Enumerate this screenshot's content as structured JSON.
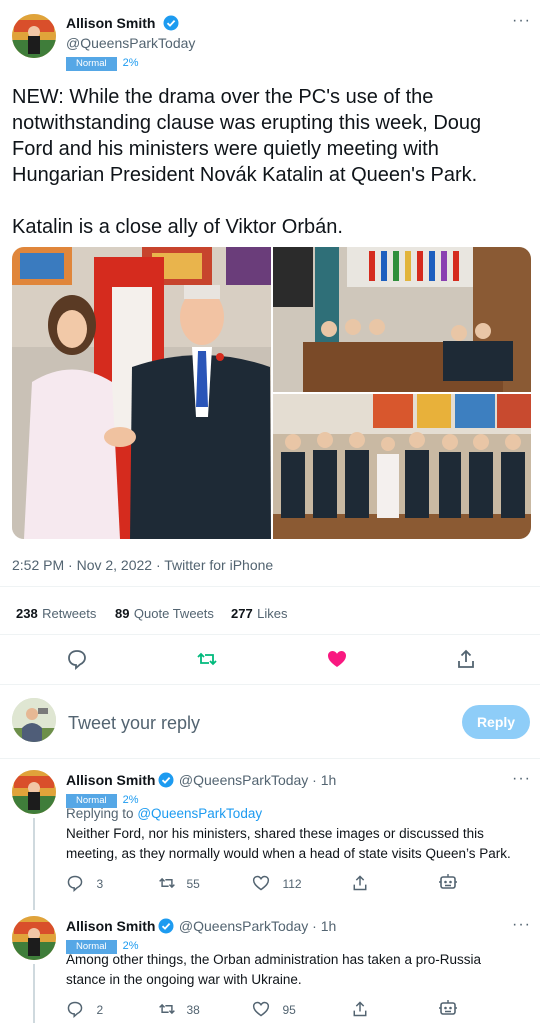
{
  "main_tweet": {
    "author_name": "Allison Smith",
    "author_handle": "@QueensParkToday",
    "badge_label": "Normal",
    "badge_pct": "2%",
    "text_line1": "NEW: While the drama over the PC's use of the",
    "text_line2": "notwithstanding clause was erupting this week, Doug",
    "text_line3": "Ford and his ministers were quietly meeting with",
    "text_line4": "Hungarian President Novák Katalin at Queen's Park.",
    "text_line5": "Katalin is a close ally of Viktor Orbán.",
    "timestamp": "2:52 PM · Nov 2, 2022 · Twitter for iPhone",
    "retweets_count": "238",
    "retweets_label": "Retweets",
    "quotes_count": "89",
    "quotes_label": "Quote Tweets",
    "likes_count": "277",
    "likes_label": "Likes"
  },
  "compose": {
    "placeholder": "Tweet your reply",
    "button_label": "Reply"
  },
  "replies": [
    {
      "author_name": "Allison Smith",
      "author_handle": "@QueensParkToday · 1h",
      "badge_label": "Normal",
      "badge_pct": "2%",
      "replying_prefix": "Replying to",
      "replying_handle": "@QueensParkToday",
      "text_line1": "Neither Ford, nor his ministers, shared these images or discussed this",
      "text_line2": "meeting, as they normally would when a head of state visits Queen’s Park.",
      "reply_count": "3",
      "retweet_count": "55",
      "like_count": "112"
    },
    {
      "author_name": "Allison Smith",
      "author_handle": "@QueensParkToday · 1h",
      "badge_label": "Normal",
      "badge_pct": "2%",
      "text_line1": "Among other things, the Orban administration has taken a pro-Russia",
      "text_line2": "stance in the ongoing war with Ukraine.",
      "reply_count": "2",
      "retweet_count": "38",
      "like_count": "95"
    }
  ],
  "colors": {
    "accent": "#1d9bf0",
    "like_active": "#f91880",
    "retweet_green": "#00ba7c",
    "muted": "#536471"
  },
  "icons": {
    "verified": "verified-badge-icon",
    "more": "more-dots-icon",
    "reply": "reply-bubble-icon",
    "retweet": "retweet-icon",
    "like": "heart-icon",
    "share": "share-icon",
    "bot": "bot-icon"
  }
}
